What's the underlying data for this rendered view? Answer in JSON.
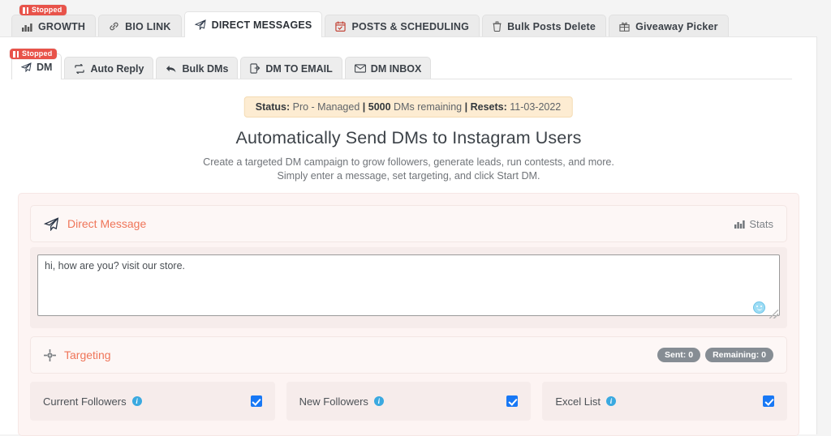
{
  "status_badges": [
    {
      "label": "Stopped",
      "icon": "pause-icon",
      "color": "#e8534a"
    },
    {
      "label": "Stopped",
      "icon": "pause-icon",
      "color": "#e8534a"
    }
  ],
  "primary_tabs": [
    {
      "label": "GROWTH",
      "icon": "bar-chart-icon",
      "active": false
    },
    {
      "label": "BIO LINK",
      "icon": "link-icon",
      "active": false
    },
    {
      "label": "DIRECT MESSAGES",
      "icon": "paper-plane-icon",
      "active": true
    },
    {
      "label": "POSTS & SCHEDULING",
      "icon": "calendar-icon",
      "active": false
    },
    {
      "label": "Bulk Posts Delete",
      "icon": "trash-icon",
      "active": false
    },
    {
      "label": "Giveaway Picker",
      "icon": "gift-icon",
      "active": false
    }
  ],
  "sub_tabs": [
    {
      "label": "DM",
      "icon": "paper-plane-icon",
      "active": true
    },
    {
      "label": "Auto Reply",
      "icon": "retweet-icon",
      "active": false
    },
    {
      "label": "Bulk DMs",
      "icon": "reply-all-icon",
      "active": false
    },
    {
      "label": "DM TO EMAIL",
      "icon": "mobile-share-icon",
      "active": false
    },
    {
      "label": "DM INBOX",
      "icon": "envelope-icon",
      "active": false
    }
  ],
  "status": {
    "status_label": "Status:",
    "plan": "Pro - Managed",
    "sep1": "|",
    "dm_count": "5000",
    "dm_text": "DMs remaining",
    "sep2": "|",
    "resets_label": "Resets:",
    "resets_date": "11-03-2022"
  },
  "heading": {
    "title": "Automatically Send DMs to Instagram Users",
    "subtitle_line1": "Create a targeted DM campaign to grow followers, generate leads, run contests, and more.",
    "subtitle_line2": "Simply enter a message, set targeting, and click Start DM."
  },
  "direct_message": {
    "title": "Direct Message",
    "icon": "paper-plane-icon",
    "stats_label": "Stats",
    "stats_icon": "bar-chart-icon",
    "message_value": "hi, how are you? visit our store.",
    "message_placeholder": "",
    "emoji_icon": "smiley-icon",
    "accent_color": "#ef7559"
  },
  "targeting": {
    "title": "Targeting",
    "icon": "crosshair-icon",
    "badges": [
      {
        "label": "Sent: 0"
      },
      {
        "label": "Remaining: 0"
      }
    ],
    "options": [
      {
        "label": "Current Followers",
        "info_icon": "info-icon",
        "checked": true
      },
      {
        "label": "New Followers",
        "info_icon": "info-icon",
        "checked": true
      },
      {
        "label": "Excel List",
        "info_icon": "info-icon",
        "checked": true
      }
    ]
  }
}
